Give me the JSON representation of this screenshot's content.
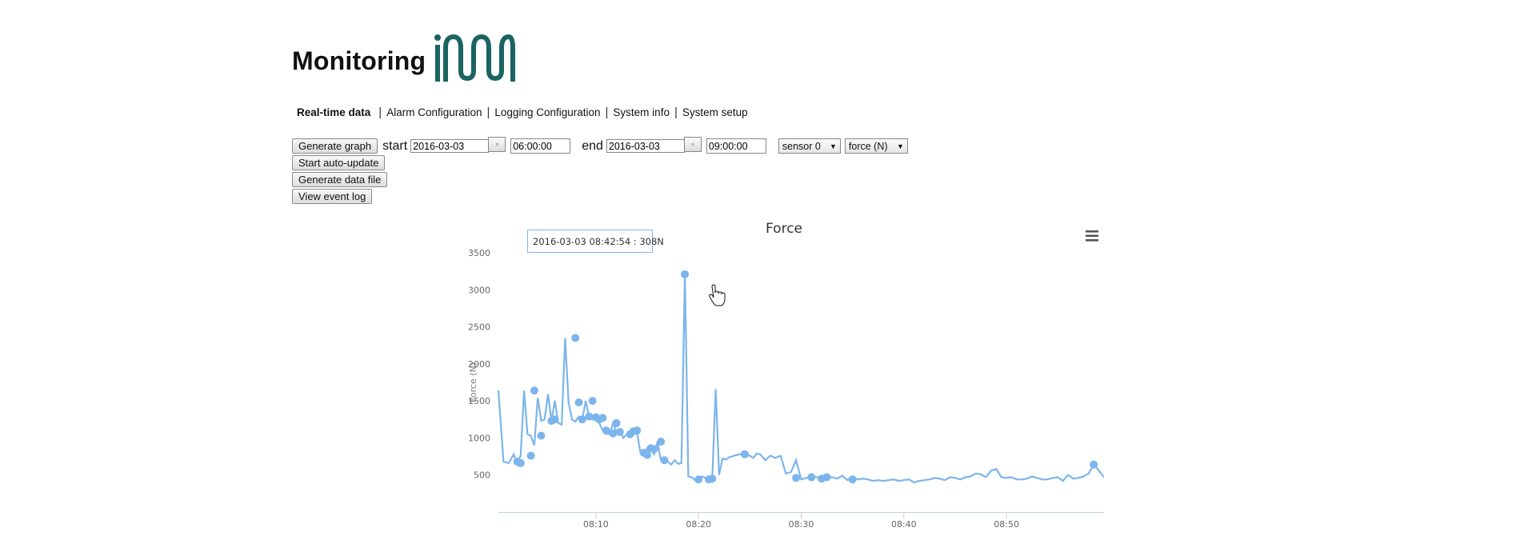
{
  "header": {
    "title": "Monitoring",
    "logo_name": "imm-logo",
    "logo_color": "#1a6462"
  },
  "nav": {
    "items": [
      {
        "label": "Real-time data",
        "active": true
      },
      {
        "label": "Alarm Configuration"
      },
      {
        "label": "Logging Configuration"
      },
      {
        "label": "System info"
      },
      {
        "label": "System setup"
      }
    ]
  },
  "controls": {
    "generate_graph": "Generate graph",
    "start_label": "start",
    "start_date": "2016-03-03",
    "start_time": "06:00:00",
    "end_label": "end",
    "end_date": "2016-03-03",
    "end_time": "09:00:00",
    "sensor": "sensor 0",
    "unit": "force (N)",
    "auto_update": "Start auto-update",
    "data_file": "Generate data file",
    "event_log": "View event log"
  },
  "chart": {
    "menu_icon": "hamburger-menu-icon",
    "tooltip": "2016-03-03 08:42:54 : 308N",
    "line_color": "#7cb5ec"
  },
  "chart_data": {
    "type": "line",
    "title": "Force",
    "ylabel": "Force (N)",
    "xlabel": "",
    "ylim": [
      0,
      3500
    ],
    "yticks": [
      500,
      1000,
      1500,
      2000,
      2500,
      3000,
      3500
    ],
    "xlim": [
      "08:00:30",
      "08:59:30"
    ],
    "xticks": [
      "08:10",
      "08:20",
      "08:30",
      "08:40",
      "08:50"
    ],
    "grid": false,
    "series": [
      {
        "x": [
          "08:00:30",
          "08:01:00",
          "08:01:30",
          "08:02:00",
          "08:02:20",
          "08:02:40",
          "08:03:00",
          "08:03:20",
          "08:03:40",
          "08:04:00",
          "08:04:20",
          "08:04:40",
          "08:05:00",
          "08:05:20",
          "08:05:40",
          "08:06:00",
          "08:06:20",
          "08:06:40",
          "08:07:00",
          "08:07:20",
          "08:07:40",
          "08:08:00",
          "08:08:20",
          "08:08:40",
          "08:09:00",
          "08:09:20",
          "08:09:40",
          "08:10:00",
          "08:10:20",
          "08:10:40",
          "08:11:00",
          "08:11:20",
          "08:11:40",
          "08:12:00",
          "08:12:20",
          "08:12:40",
          "08:13:00",
          "08:13:20",
          "08:13:40",
          "08:14:00",
          "08:14:20",
          "08:14:40",
          "08:15:00",
          "08:15:20",
          "08:15:40",
          "08:16:00",
          "08:16:20",
          "08:16:40",
          "08:17:00",
          "08:17:20",
          "08:17:40",
          "08:18:00",
          "08:18:20",
          "08:18:40",
          "08:19:00",
          "08:19:20",
          "08:19:40",
          "08:20:00",
          "08:20:20",
          "08:20:40",
          "08:21:00",
          "08:21:20",
          "08:21:40",
          "08:22:00",
          "08:22:20",
          "08:22:40",
          "08:23:00",
          "08:23:30",
          "08:24:00",
          "08:24:30",
          "08:25:00",
          "08:25:20",
          "08:25:40",
          "08:26:00",
          "08:26:30",
          "08:27:00",
          "08:27:30",
          "08:28:00",
          "08:28:30",
          "08:29:00",
          "08:29:30",
          "08:30:00",
          "08:30:30",
          "08:31:00",
          "08:31:30",
          "08:32:00",
          "08:32:30",
          "08:33:00",
          "08:33:30",
          "08:34:00",
          "08:34:30",
          "08:35:00",
          "08:35:30",
          "08:36:00",
          "08:36:30",
          "08:37:00",
          "08:37:30",
          "08:38:00",
          "08:38:30",
          "08:39:00",
          "08:39:30",
          "08:40:00",
          "08:40:30",
          "08:41:00",
          "08:41:30",
          "08:42:00",
          "08:42:30",
          "08:43:00",
          "08:43:30",
          "08:44:00",
          "08:44:30",
          "08:45:00",
          "08:45:30",
          "08:46:00",
          "08:46:30",
          "08:47:00",
          "08:47:30",
          "08:48:00",
          "08:48:30",
          "08:49:00",
          "08:49:30",
          "08:50:00",
          "08:50:30",
          "08:51:00",
          "08:51:30",
          "08:52:00",
          "08:52:30",
          "08:53:00",
          "08:53:30",
          "08:54:00",
          "08:54:30",
          "08:55:00",
          "08:55:30",
          "08:56:00",
          "08:56:30",
          "08:57:00",
          "08:57:30",
          "08:58:00",
          "08:58:30",
          "08:59:00",
          "08:59:30"
        ],
        "values": [
          1640,
          680,
          660,
          780,
          650,
          760,
          1640,
          1050,
          1030,
          900,
          1540,
          1230,
          1250,
          1590,
          1230,
          1500,
          1200,
          1180,
          2350,
          1480,
          1250,
          1220,
          1290,
          1240,
          1500,
          1280,
          1250,
          1270,
          1200,
          1100,
          1060,
          1050,
          1200,
          1080,
          1100,
          1000,
          1050,
          1090,
          1100,
          1080,
          800,
          770,
          860,
          850,
          780,
          950,
          700,
          690,
          680,
          640,
          700,
          650,
          660,
          3210,
          480,
          470,
          430,
          460,
          480,
          460,
          440,
          450,
          1660,
          500,
          720,
          710,
          740,
          760,
          780,
          770,
          760,
          730,
          790,
          780,
          700,
          760,
          730,
          760,
          520,
          540,
          700,
          440,
          460,
          480,
          470,
          460,
          450,
          470,
          450,
          490,
          430,
          480,
          440,
          450,
          440,
          420,
          430,
          420,
          430,
          440,
          420,
          430,
          440,
          400,
          420,
          430,
          440,
          460,
          450,
          430,
          470,
          460,
          440,
          470,
          480,
          520,
          510,
          470,
          560,
          580,
          470,
          460,
          470,
          440,
          440,
          450,
          480,
          460,
          440,
          440,
          460,
          470,
          420,
          500,
          450,
          460,
          480,
          520,
          640,
          560,
          470
        ]
      }
    ],
    "markers": [
      {
        "x": "08:02:20",
        "y": 680
      },
      {
        "x": "08:02:40",
        "y": 660
      },
      {
        "x": "08:03:40",
        "y": 760
      },
      {
        "x": "08:04:00",
        "y": 1640
      },
      {
        "x": "08:04:40",
        "y": 1030
      },
      {
        "x": "08:05:40",
        "y": 1230
      },
      {
        "x": "08:06:00",
        "y": 1250
      },
      {
        "x": "08:08:00",
        "y": 2350
      },
      {
        "x": "08:08:20",
        "y": 1480
      },
      {
        "x": "08:08:40",
        "y": 1250
      },
      {
        "x": "08:09:20",
        "y": 1290
      },
      {
        "x": "08:09:40",
        "y": 1500
      },
      {
        "x": "08:10:00",
        "y": 1280
      },
      {
        "x": "08:10:20",
        "y": 1250
      },
      {
        "x": "08:10:40",
        "y": 1270
      },
      {
        "x": "08:11:00",
        "y": 1100
      },
      {
        "x": "08:11:40",
        "y": 1060
      },
      {
        "x": "08:12:00",
        "y": 1200
      },
      {
        "x": "08:12:20",
        "y": 1080
      },
      {
        "x": "08:13:20",
        "y": 1050
      },
      {
        "x": "08:13:40",
        "y": 1090
      },
      {
        "x": "08:14:00",
        "y": 1100
      },
      {
        "x": "08:14:40",
        "y": 800
      },
      {
        "x": "08:15:00",
        "y": 770
      },
      {
        "x": "08:15:20",
        "y": 860
      },
      {
        "x": "08:15:40",
        "y": 850
      },
      {
        "x": "08:16:20",
        "y": 950
      },
      {
        "x": "08:16:40",
        "y": 700
      },
      {
        "x": "08:18:40",
        "y": 3210
      },
      {
        "x": "08:20:00",
        "y": 440
      },
      {
        "x": "08:21:00",
        "y": 440
      },
      {
        "x": "08:21:20",
        "y": 450
      },
      {
        "x": "08:24:30",
        "y": 780
      },
      {
        "x": "08:29:30",
        "y": 460
      },
      {
        "x": "08:31:00",
        "y": 470
      },
      {
        "x": "08:32:00",
        "y": 450
      },
      {
        "x": "08:32:30",
        "y": 470
      },
      {
        "x": "08:35:00",
        "y": 440
      },
      {
        "x": "08:58:30",
        "y": 640
      }
    ]
  }
}
